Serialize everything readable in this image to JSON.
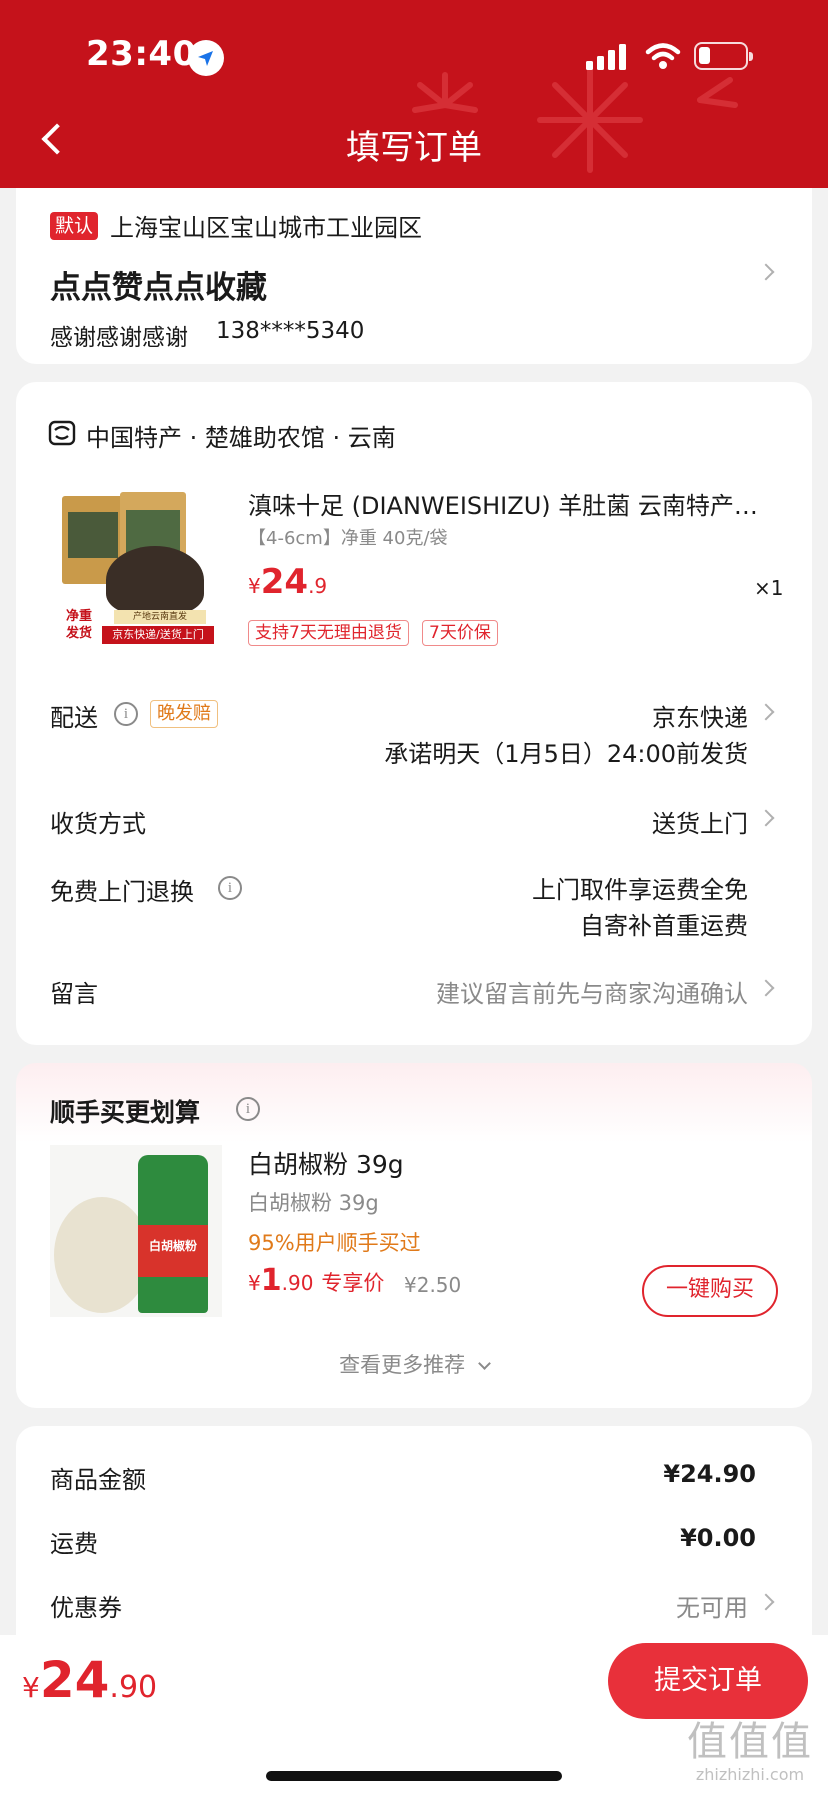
{
  "status_bar": {
    "time": "23:40"
  },
  "header": {
    "title": "填写订单"
  },
  "address": {
    "default_tag": "默认",
    "region": "上海宝山区宝山城市工业园区",
    "name": "点点赞点点收藏",
    "contact_name": "感谢感谢感谢",
    "phone": "138****5340"
  },
  "shop": {
    "name": "中国特产 · 楚雄助农馆 · 云南"
  },
  "product": {
    "title": "滇味十足 (DIANWEISHIZU) 羊肚菌 云南特产…",
    "spec": "【4-6cm】净重 40克/袋",
    "price_symbol": "¥",
    "price_int": "24",
    "price_dec": ".9",
    "quantity": "×1",
    "tags": [
      "支持7天无理由退货",
      "7天价保"
    ],
    "image_text": {
      "label_left": "净重\n发货",
      "label_origin": "产地云南直发",
      "label_delivery": "京东快递/送货上门"
    }
  },
  "delivery": {
    "label": "配送",
    "badge": "晚发赔",
    "carrier": "京东快递",
    "promise": "承诺明天（1月5日）24:00前发货"
  },
  "receive": {
    "label": "收货方式",
    "value": "送货上门"
  },
  "returns": {
    "label": "免费上门退换",
    "line1": "上门取件享运费全免",
    "line2": "自寄补首重运费"
  },
  "message": {
    "label": "留言",
    "placeholder": "建议留言前先与商家沟通确认"
  },
  "upsell": {
    "title": "顺手买更划算",
    "item_title": "白胡椒粉 39g",
    "item_sub": "白胡椒粉 39g",
    "item_hint": "95%用户顺手买过",
    "price_symbol": "¥",
    "price_int": "1",
    "price_dec": ".90",
    "price_label": "专享价",
    "orig_price": "¥2.50",
    "buy_button": "一键购买",
    "more": "查看更多推荐",
    "jar_label": "白胡椒粉"
  },
  "summary": {
    "goods_label": "商品金额",
    "goods_value": "¥24.90",
    "shipping_label": "运费",
    "shipping_value": "¥0.00",
    "coupon_label": "优惠券",
    "coupon_value": "无可用"
  },
  "footer": {
    "total_symbol": "¥",
    "total_int": "24",
    "total_dec": ".90",
    "submit_label": "提交订单"
  },
  "watermark": {
    "text": "值值值",
    "url": "zhizhizhi.com"
  },
  "colors": {
    "header_red": "#c5121b",
    "accent_red": "#e0242d",
    "orange": "#e07a1a"
  }
}
